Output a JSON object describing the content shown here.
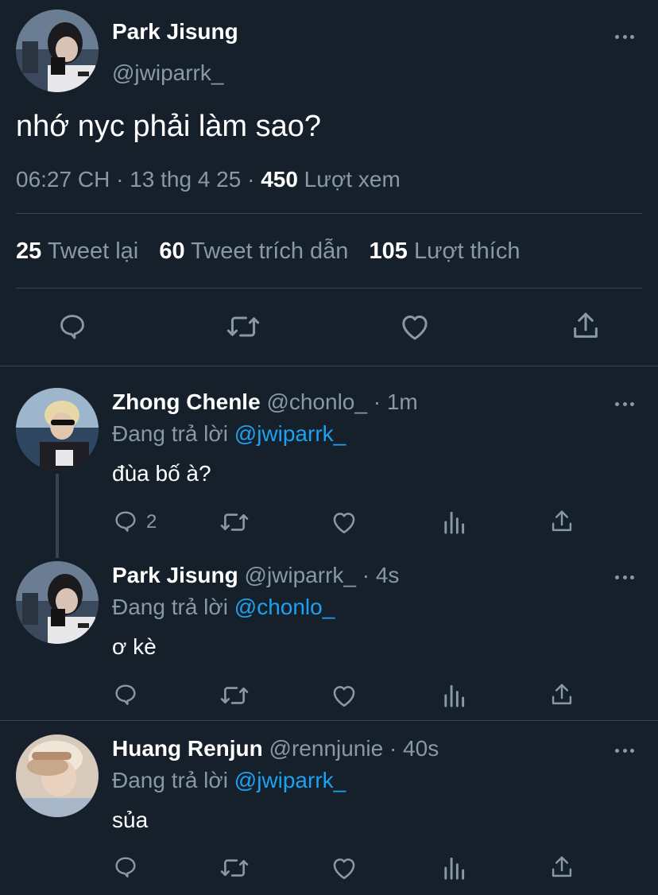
{
  "main_tweet": {
    "display_name": "Park Jisung",
    "handle": "@jwiparrk_",
    "text": "nhớ nyc phải làm sao?",
    "time": "06:27 CH · 13 thg 4 25 · ",
    "views_count": "450",
    "views_label": " Lượt xem",
    "stats": {
      "retweets_count": "25",
      "retweets_label": "Tweet lại",
      "quotes_count": "60",
      "quotes_label": "Tweet trích dẫn",
      "likes_count": "105",
      "likes_label": "Lượt thích"
    }
  },
  "replies": [
    {
      "display_name": "Zhong Chenle",
      "handle_time": "@chonlo_ · 1m",
      "replying_prefix": "Đang trả lời ",
      "replying_to": "@jwiparrk_",
      "text": "đùa bố à?",
      "reply_count": "2"
    },
    {
      "display_name": "Park Jisung",
      "handle_time": "@jwiparrk_ · 4s",
      "replying_prefix": "Đang trả lời ",
      "replying_to": "@chonlo_",
      "text": "ơ kè",
      "reply_count": ""
    },
    {
      "display_name": "Huang Renjun",
      "handle_time": "@rennjunie · 40s",
      "replying_prefix": "Đang trả lời ",
      "replying_to": "@jwiparrk_",
      "text": "sủa",
      "reply_count": ""
    }
  ],
  "icons": {
    "reply": "speech-bubble-icon",
    "retweet": "retweet-arrows-icon",
    "like": "heart-icon",
    "analytics": "bar-chart-icon",
    "share": "share-upload-icon",
    "more": "more-dots-icon"
  },
  "colors": {
    "background": "#15202b",
    "muted": "#8899a6",
    "link": "#1da1f2",
    "divider": "#38444d"
  }
}
